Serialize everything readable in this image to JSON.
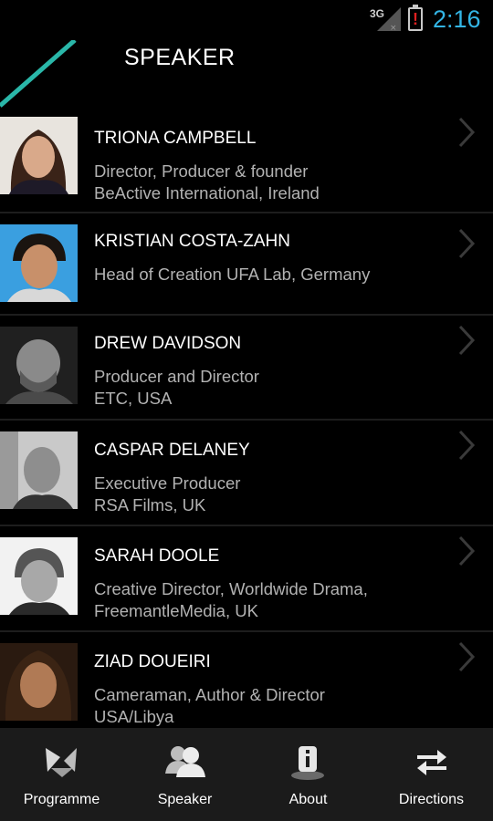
{
  "status_bar": {
    "network": "3G",
    "battery_alert": "!",
    "time": "2:16"
  },
  "header": {
    "title": "SPEAKER"
  },
  "speakers": [
    {
      "name": "TRIONA CAMPBELL",
      "role_line1": "Director, Producer & founder",
      "role_line2": "BeActive International, Ireland"
    },
    {
      "name": "KRISTIAN COSTA-ZAHN",
      "role_line1": "Head of Creation UFA Lab, Germany",
      "role_line2": ""
    },
    {
      "name": "DREW DAVIDSON",
      "role_line1": "Producer and Director",
      "role_line2": "ETC, USA"
    },
    {
      "name": "CASPAR DELANEY",
      "role_line1": "Executive Producer",
      "role_line2": "RSA Films, UK"
    },
    {
      "name": "SARAH DOOLE",
      "role_line1": "Creative Director, Worldwide Drama,",
      "role_line2": "FreemantleMedia, UK"
    },
    {
      "name": "ZIAD DOUEIRI",
      "role_line1": "Cameraman, Author & Director",
      "role_line2": "USA/Libya"
    }
  ],
  "bottom_nav": [
    {
      "label": "Programme",
      "icon": "programme-icon"
    },
    {
      "label": "Speaker",
      "icon": "people-icon"
    },
    {
      "label": "About",
      "icon": "info-icon"
    },
    {
      "label": "Directions",
      "icon": "arrows-exchange-icon"
    }
  ],
  "colors": {
    "accent_teal": "#2ab7a9",
    "clock_blue": "#33b5e5",
    "secondary_text": "#b2b2b2",
    "nav_bg": "#1b1b1b"
  }
}
